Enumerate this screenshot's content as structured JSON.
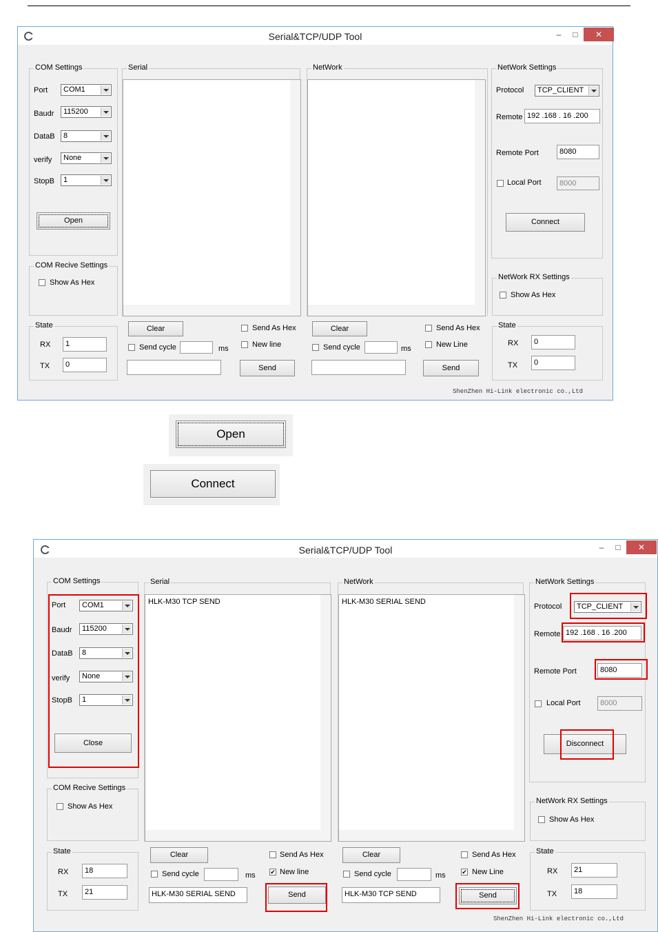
{
  "win1": {
    "title": "Serial&TCP/UDP Tool",
    "min_glyph": "–",
    "max_glyph": "□",
    "close_glyph": "✕",
    "com_settings": {
      "label": "COM Settings",
      "port_label": "Port",
      "port_value": "COM1",
      "baud_label": "Baudr",
      "baud_value": "115200",
      "datab_label": "DataB",
      "datab_value": "8",
      "verify_label": "verify",
      "verify_value": "None",
      "stopb_label": "StopB",
      "stopb_value": "1",
      "open_button": "Open"
    },
    "com_rx": {
      "label": "COM Recive Settings",
      "show_hex": "Show As Hex"
    },
    "state_left": {
      "label": "State",
      "rx_label": "RX",
      "rx_value": "1",
      "tx_label": "TX",
      "tx_value": "0"
    },
    "serial": {
      "label": "Serial",
      "content": "",
      "clear": "Clear",
      "send_as_hex": "Send As Hex",
      "send_cycle": "Send cycle",
      "cycle_value": "",
      "ms": "ms",
      "new_line": "New line",
      "send": "Send",
      "send_text": ""
    },
    "network": {
      "label": "NetWork",
      "content": "",
      "clear": "Clear",
      "send_as_hex": "Send As Hex",
      "send_cycle": "Send cycle",
      "cycle_value": "",
      "ms": "ms",
      "new_line": "New Line",
      "send": "Send",
      "send_text": ""
    },
    "net_settings": {
      "label": "NetWork Settings",
      "protocol_label": "Protocol",
      "protocol_value": "TCP_CLIENT",
      "remote_label": "Remote",
      "remote_value": "192 .168 . 16 .200",
      "remote_port_label": "Remote Port",
      "remote_port_value": "8080",
      "local_port_label": "Local Port",
      "local_port_value": "8000",
      "connect_button": "Connect"
    },
    "net_rx": {
      "label": "NetWork RX Settings",
      "show_hex": "Show As Hex"
    },
    "state_right": {
      "label": "State",
      "rx_label": "RX",
      "rx_value": "0",
      "tx_label": "TX",
      "tx_value": "0"
    },
    "footer": "ShenZhen Hi-Link electronic co.,Ltd"
  },
  "crops": {
    "open_button": "Open",
    "connect_button": "Connect"
  },
  "win2": {
    "title": "Serial&TCP/UDP Tool",
    "min_glyph": "–",
    "max_glyph": "□",
    "close_glyph": "✕",
    "com_settings": {
      "label": "COM Settings",
      "port_label": "Port",
      "port_value": "COM1",
      "baud_label": "Baudr",
      "baud_value": "115200",
      "datab_label": "DataB",
      "datab_value": "8",
      "verify_label": "verify",
      "verify_value": "None",
      "stopb_label": "StopB",
      "stopb_value": "1",
      "close_button": "Close"
    },
    "com_rx": {
      "label": "COM Recive Settings",
      "show_hex": "Show As Hex"
    },
    "state_left": {
      "label": "State",
      "rx_label": "RX",
      "rx_value": "18",
      "tx_label": "TX",
      "tx_value": "21"
    },
    "serial": {
      "label": "Serial",
      "content": "HLK-M30 TCP SEND",
      "clear": "Clear",
      "send_as_hex": "Send As Hex",
      "send_cycle": "Send cycle",
      "cycle_value": "",
      "ms": "ms",
      "new_line": "New line",
      "send": "Send",
      "send_text": "HLK-M30 SERIAL SEND"
    },
    "network": {
      "label": "NetWork",
      "content": "HLK-M30 SERIAL SEND",
      "clear": "Clear",
      "send_as_hex": "Send As Hex",
      "send_cycle": "Send cycle",
      "cycle_value": "",
      "ms": "ms",
      "new_line": "New Line",
      "send": "Send",
      "send_text": "HLK-M30 TCP SEND"
    },
    "net_settings": {
      "label": "NetWork Settings",
      "protocol_label": "Protocol",
      "protocol_value": "TCP_CLIENT",
      "remote_label": "Remote",
      "remote_value": "192 .168 . 16 .200",
      "remote_port_label": "Remote Port",
      "remote_port_value": "8080",
      "local_port_label": "Local Port",
      "local_port_value": "8000",
      "disconnect_button": "Disconnect"
    },
    "net_rx": {
      "label": "NetWork RX Settings",
      "show_hex": "Show As Hex"
    },
    "state_right": {
      "label": "State",
      "rx_label": "RX",
      "rx_value": "21",
      "tx_label": "TX",
      "tx_value": "18"
    },
    "footer": "ShenZhen Hi-Link electronic co.,Ltd",
    "new_line_checked": "✔"
  }
}
